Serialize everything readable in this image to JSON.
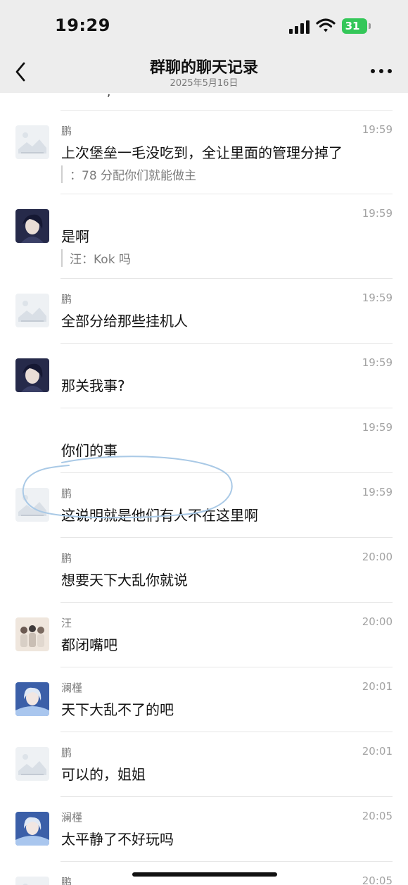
{
  "status_bar": {
    "time": "19:29",
    "battery": "31"
  },
  "header": {
    "title": "群聊的聊天记录",
    "date": "2025年5月16日"
  },
  "messages": [
    {
      "sender": "鹏",
      "time": "19:59",
      "text": "上次堡垒一毛没吃到，全让里面的管理分掉了",
      "quote": "：78 分配你们就能做主",
      "avatar": "placeholder-image-icon"
    },
    {
      "sender": "",
      "time": "19:59",
      "text": "是啊",
      "quote": "汪：Kok 吗",
      "avatar": "anime-boy-avatar"
    },
    {
      "sender": "鹏",
      "time": "19:59",
      "text": "全部分给那些挂机人",
      "avatar": "placeholder-image-icon"
    },
    {
      "sender": "",
      "time": "19:59",
      "text": "那关我事?",
      "avatar": "anime-boy-avatar"
    },
    {
      "sender": "",
      "time": "19:59",
      "text": "你们的事",
      "avatar": ""
    },
    {
      "sender": "鹏",
      "time": "19:59",
      "text": "这说明就是他们有人不在这里啊",
      "avatar": "placeholder-image-icon"
    },
    {
      "sender": "鹏",
      "time": "20:00",
      "text": "想要天下大乱你就说",
      "avatar": ""
    },
    {
      "sender": "汪",
      "time": "20:00",
      "text": "都闭嘴吧",
      "avatar": "group-photo-avatar"
    },
    {
      "sender": "澜槿",
      "time": "20:01",
      "text": "天下大乱不了的吧",
      "avatar": "anime-girl-avatar"
    },
    {
      "sender": "鹏",
      "time": "20:01",
      "text": "可以的，姐姐",
      "avatar": "placeholder-image-icon"
    },
    {
      "sender": "澜槿",
      "time": "20:05",
      "text": "太平静了不好玩吗",
      "avatar": "anime-girl-avatar"
    },
    {
      "sender": "鹏",
      "time": "20:05",
      "text": "",
      "avatar": "placeholder-image-icon"
    }
  ],
  "colors": {
    "header_bg": "#ededed",
    "battery": "#34c759",
    "annotation_circle": "#a9c9e6"
  }
}
